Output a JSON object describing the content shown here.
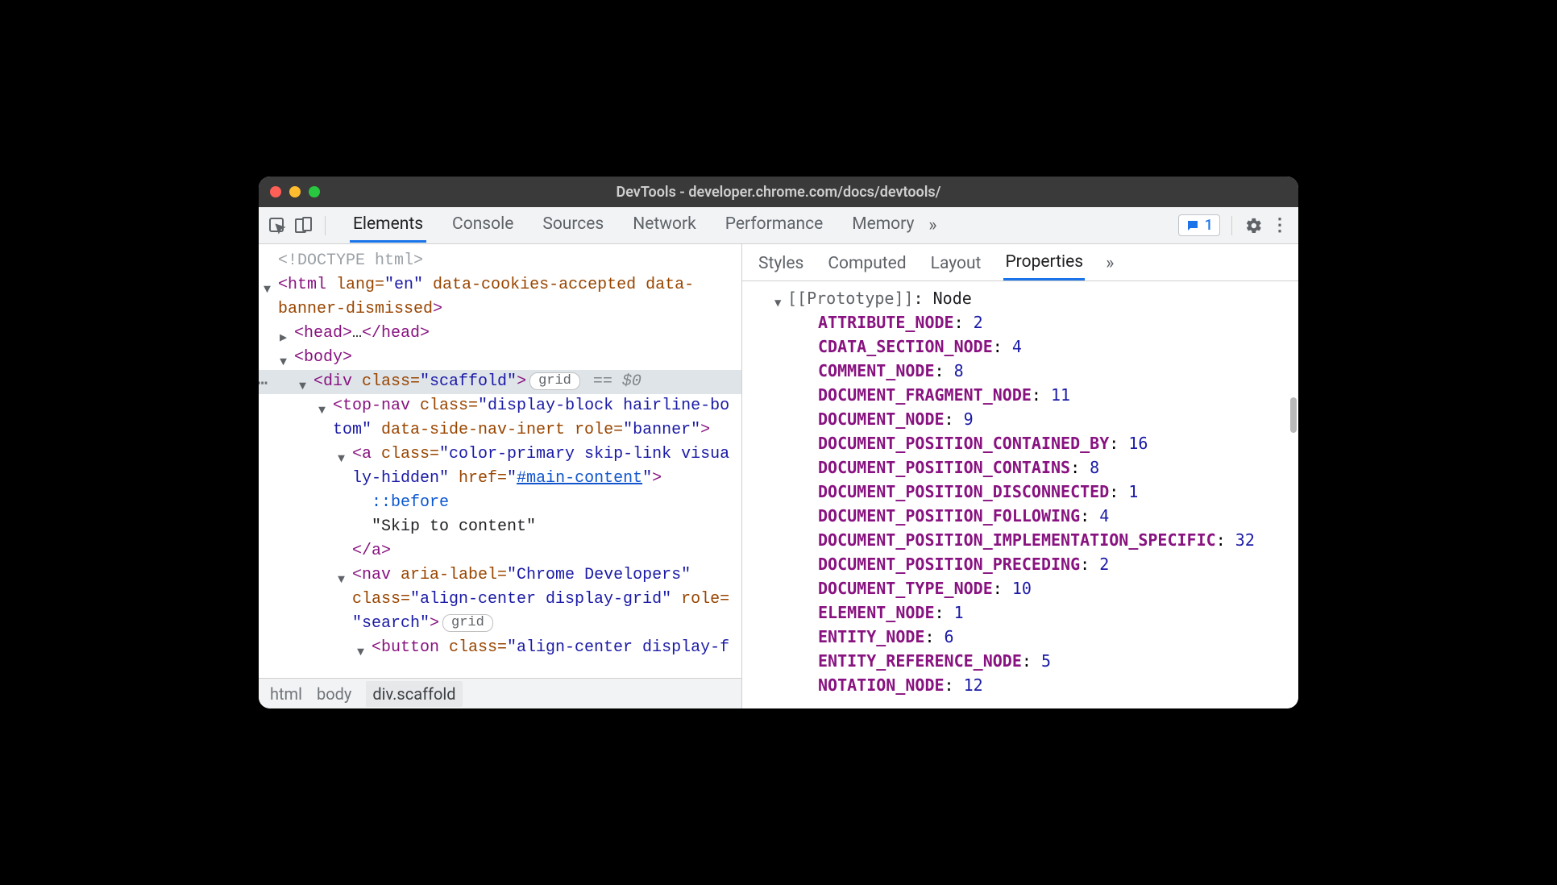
{
  "titlebar": {
    "title": "DevTools - developer.chrome.com/docs/devtools/"
  },
  "main_tabs": [
    "Elements",
    "Console",
    "Sources",
    "Network",
    "Performance",
    "Memory"
  ],
  "main_tab_active": 0,
  "issues_count": "1",
  "dom": {
    "line_doctype": "<!DOCTYPE html>",
    "line_html_open_1": "<html lang=\"en\" data-cookies-accepted data-",
    "line_html_open_2": "banner-dismissed>",
    "line_head": "<head>…</head>",
    "line_body": "<body>",
    "line_div_scaffold": "<div class=\"scaffold\">",
    "badge_grid": "grid",
    "eq0": "== $0",
    "line_topnav_1": "<top-nav class=\"display-block hairline-bo",
    "line_topnav_2": "tom\" data-side-nav-inert role=\"banner\">",
    "line_a_1": "<a class=\"color-primary skip-link visua",
    "line_a_2_pre": "ly-hidden\" href=\"",
    "line_a_2_href": "#main-content",
    "line_a_2_post": "\">",
    "line_before": "::before",
    "line_skip_text": "\"Skip to content\"",
    "line_a_close": "</a>",
    "line_nav_1": "<nav aria-label=\"Chrome Developers\"",
    "line_nav_2": "class=\"align-center display-grid\" role=",
    "line_nav_3": "\"search\">",
    "badge_grid2": "grid",
    "line_button": "<button class=\"align-center display-f"
  },
  "breadcrumb": [
    "html",
    "body",
    "div.scaffold"
  ],
  "breadcrumb_active": 2,
  "side_tabs": [
    "Styles",
    "Computed",
    "Layout",
    "Properties"
  ],
  "side_tab_active": 3,
  "proto_label": "[[Prototype]]",
  "proto_value": "Node",
  "props": [
    {
      "name": "ATTRIBUTE_NODE",
      "value": "2"
    },
    {
      "name": "CDATA_SECTION_NODE",
      "value": "4"
    },
    {
      "name": "COMMENT_NODE",
      "value": "8"
    },
    {
      "name": "DOCUMENT_FRAGMENT_NODE",
      "value": "11"
    },
    {
      "name": "DOCUMENT_NODE",
      "value": "9"
    },
    {
      "name": "DOCUMENT_POSITION_CONTAINED_BY",
      "value": "16"
    },
    {
      "name": "DOCUMENT_POSITION_CONTAINS",
      "value": "8"
    },
    {
      "name": "DOCUMENT_POSITION_DISCONNECTED",
      "value": "1"
    },
    {
      "name": "DOCUMENT_POSITION_FOLLOWING",
      "value": "4"
    },
    {
      "name": "DOCUMENT_POSITION_IMPLEMENTATION_SPECIFIC",
      "value": "32"
    },
    {
      "name": "DOCUMENT_POSITION_PRECEDING",
      "value": "2"
    },
    {
      "name": "DOCUMENT_TYPE_NODE",
      "value": "10"
    },
    {
      "name": "ELEMENT_NODE",
      "value": "1"
    },
    {
      "name": "ENTITY_NODE",
      "value": "6"
    },
    {
      "name": "ENTITY_REFERENCE_NODE",
      "value": "5"
    },
    {
      "name": "NOTATION_NODE",
      "value": "12"
    }
  ]
}
